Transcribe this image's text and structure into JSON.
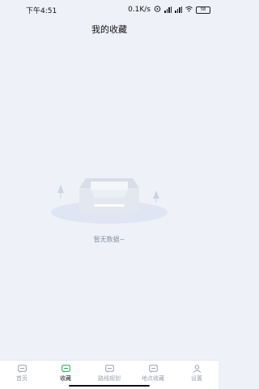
{
  "status_bar": {
    "time": "下午4:51",
    "speed": "0.1K/s",
    "battery": "58"
  },
  "header": {
    "title": "我的收藏"
  },
  "empty_state": {
    "message": "暂无数据~"
  },
  "tabbar": {
    "tabs": [
      {
        "label": "首页",
        "icon": "home-icon"
      },
      {
        "label": "收藏",
        "icon": "favorites-icon",
        "active": true
      },
      {
        "label": "路线规划",
        "icon": "route-icon"
      },
      {
        "label": "地点收藏",
        "icon": "location-icon"
      },
      {
        "label": "设置",
        "icon": "user-icon"
      }
    ]
  },
  "colors": {
    "background": "#eef1f8",
    "active": "#2aa84a",
    "inactive": "#9aa1ad"
  }
}
